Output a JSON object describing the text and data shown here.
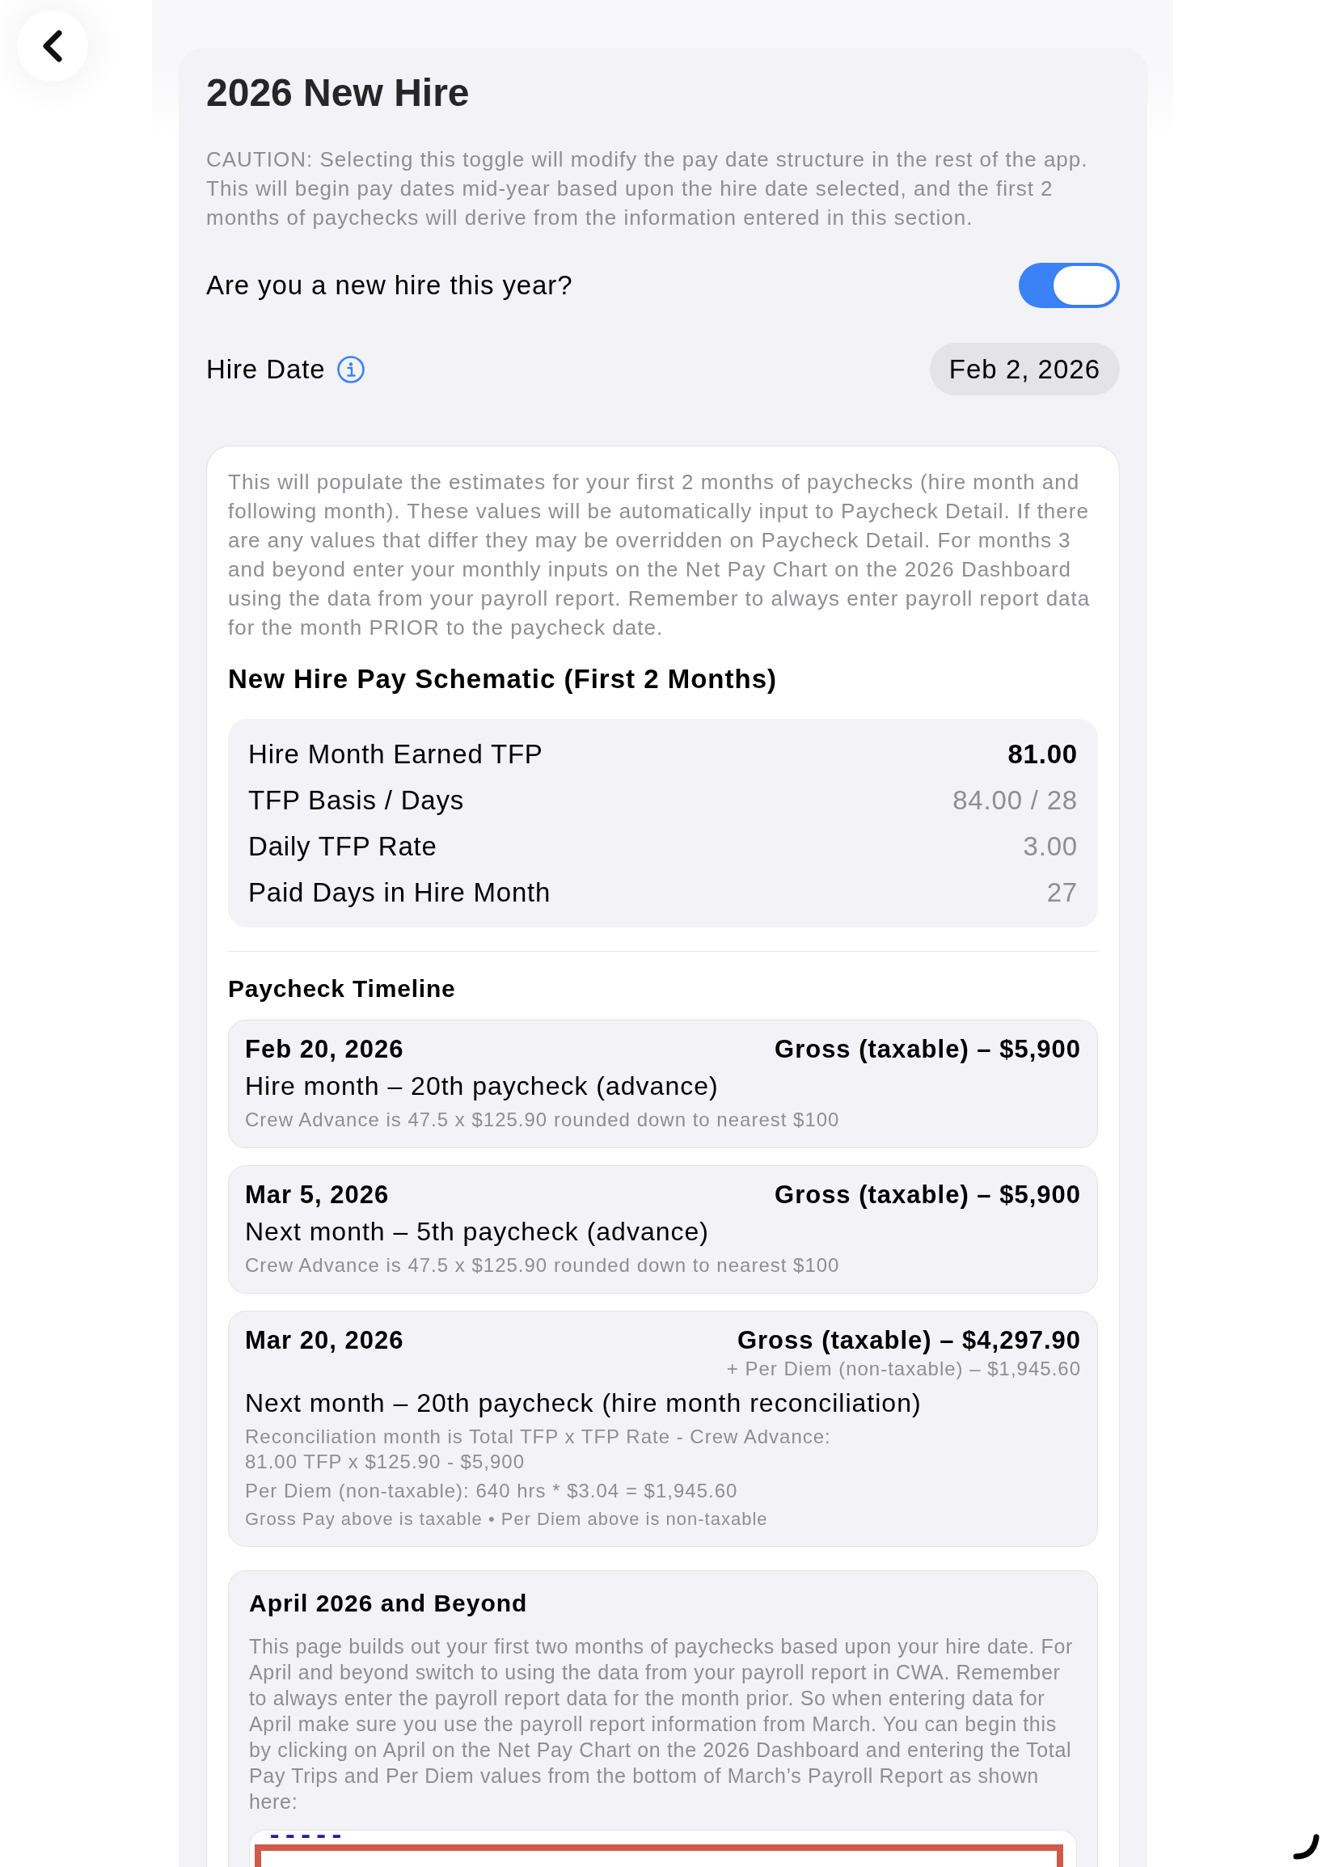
{
  "page": {
    "title": "2026 New Hire",
    "caution": "CAUTION: Selecting this toggle will modify the pay date structure in the rest of the app. This will begin pay dates mid-year based upon the hire date selected, and the first 2 months of paychecks will derive from the information entered in this section."
  },
  "new_hire_toggle": {
    "label": "Are you a new hire this year?",
    "on": true
  },
  "hire_date": {
    "label": "Hire Date",
    "value": "Feb 2, 2026"
  },
  "info_card": {
    "description": "This will populate the estimates for your first 2 months of paychecks (hire month and following month). These values will be automatically input to Paycheck Detail. If there are any values that differ they may be overridden on Paycheck Detail. For months 3 and beyond enter your monthly inputs on the Net Pay Chart on the 2026 Dashboard using the data from your payroll report. Remember to always enter payroll report data for the month PRIOR to the paycheck date.",
    "schematic": {
      "title": "New Hire Pay Schematic (First 2 Months)",
      "rows": [
        {
          "label": "Hire Month Earned TFP",
          "value": "81.00",
          "emphasized": true
        },
        {
          "label": "TFP Basis / Days",
          "value": "84.00 / 28",
          "emphasized": false
        },
        {
          "label": "Daily TFP Rate",
          "value": "3.00",
          "emphasized": false
        },
        {
          "label": "Paid Days in Hire Month",
          "value": "27",
          "emphasized": false
        }
      ]
    },
    "timeline": {
      "title": "Paycheck Timeline",
      "items": [
        {
          "date": "Feb 20, 2026",
          "gross": "Gross (taxable) – $5,900",
          "title": "Hire month – 20th paycheck (advance)",
          "notes": [
            "Crew Advance is 47.5 x $125.90 rounded down to nearest $100"
          ]
        },
        {
          "date": "Mar 5, 2026",
          "gross": "Gross (taxable) – $5,900",
          "title": "Next month – 5th paycheck (advance)",
          "notes": [
            "Crew Advance is 47.5 x $125.90 rounded down to nearest $100"
          ]
        },
        {
          "date": "Mar 20, 2026",
          "gross": "Gross (taxable) – $4,297.90",
          "per_diem": "+ Per Diem (non-taxable) – $1,945.60",
          "title": "Next month – 20th paycheck (hire month reconciliation)",
          "notes": [
            "Reconciliation month is Total TFP x TFP Rate - Crew Advance:\n81.00 TFP x $125.90 - $5,900",
            "Per Diem (non-taxable): 640 hrs * $3.04 = $1,945.60"
          ],
          "footnote": "Gross Pay above is taxable • Per Diem above is non-taxable"
        }
      ]
    },
    "beyond": {
      "title": "April 2026 and Beyond",
      "text": "This page builds out your first two months of paychecks based upon your hire date. For April and beyond switch to using the data from your payroll report in CWA. Remember to always enter the payroll report data for the month prior. So when entering data for April make sure you use the payroll report information from March. You can begin this by clicking on April on the Net Pay Chart on the 2026 Dashboard and entering the Total Pay Trips and Per Diem values from the bottom of March’s Payroll Report as shown here:",
      "report_excerpt": {
        "lines": [
          "-----"
        ]
      }
    }
  }
}
